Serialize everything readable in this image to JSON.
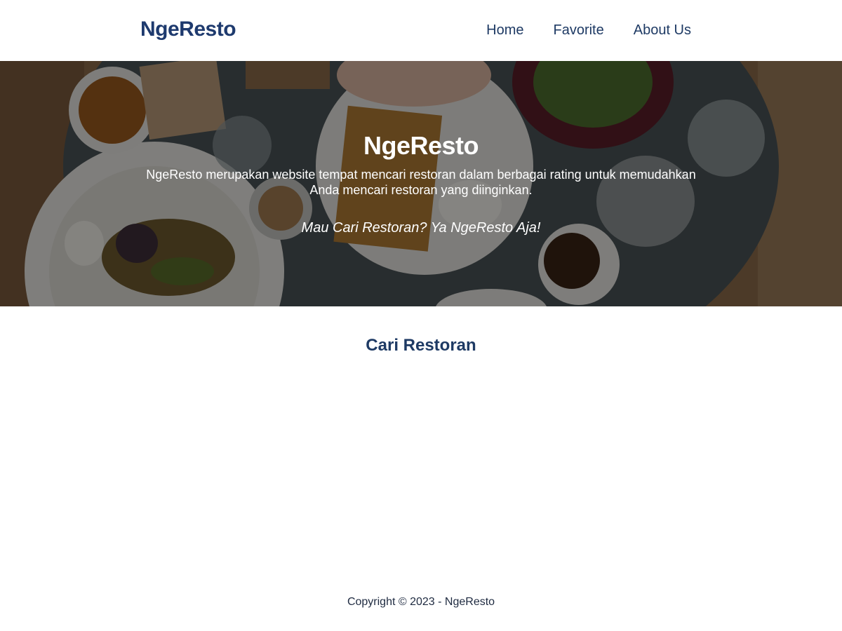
{
  "navbar": {
    "brand": "NgeResto",
    "links": [
      {
        "label": "Home"
      },
      {
        "label": "Favorite"
      },
      {
        "label": "About Us"
      }
    ]
  },
  "hero": {
    "title": "NgeResto",
    "description": "NgeResto merupakan website tempat mencari restoran dalam berbagai rating untuk memudahkan Anda mencari restoran yang diinginkan.",
    "tagline": "Mau Cari Restoran? Ya NgeResto Aja!"
  },
  "main": {
    "section_title": "Cari Restoran"
  },
  "footer": {
    "copyright": "Copyright © 2023 - NgeResto"
  },
  "colors": {
    "brand": "#1e3a6e",
    "text": "#1e3a64",
    "overlay": "#000000"
  }
}
